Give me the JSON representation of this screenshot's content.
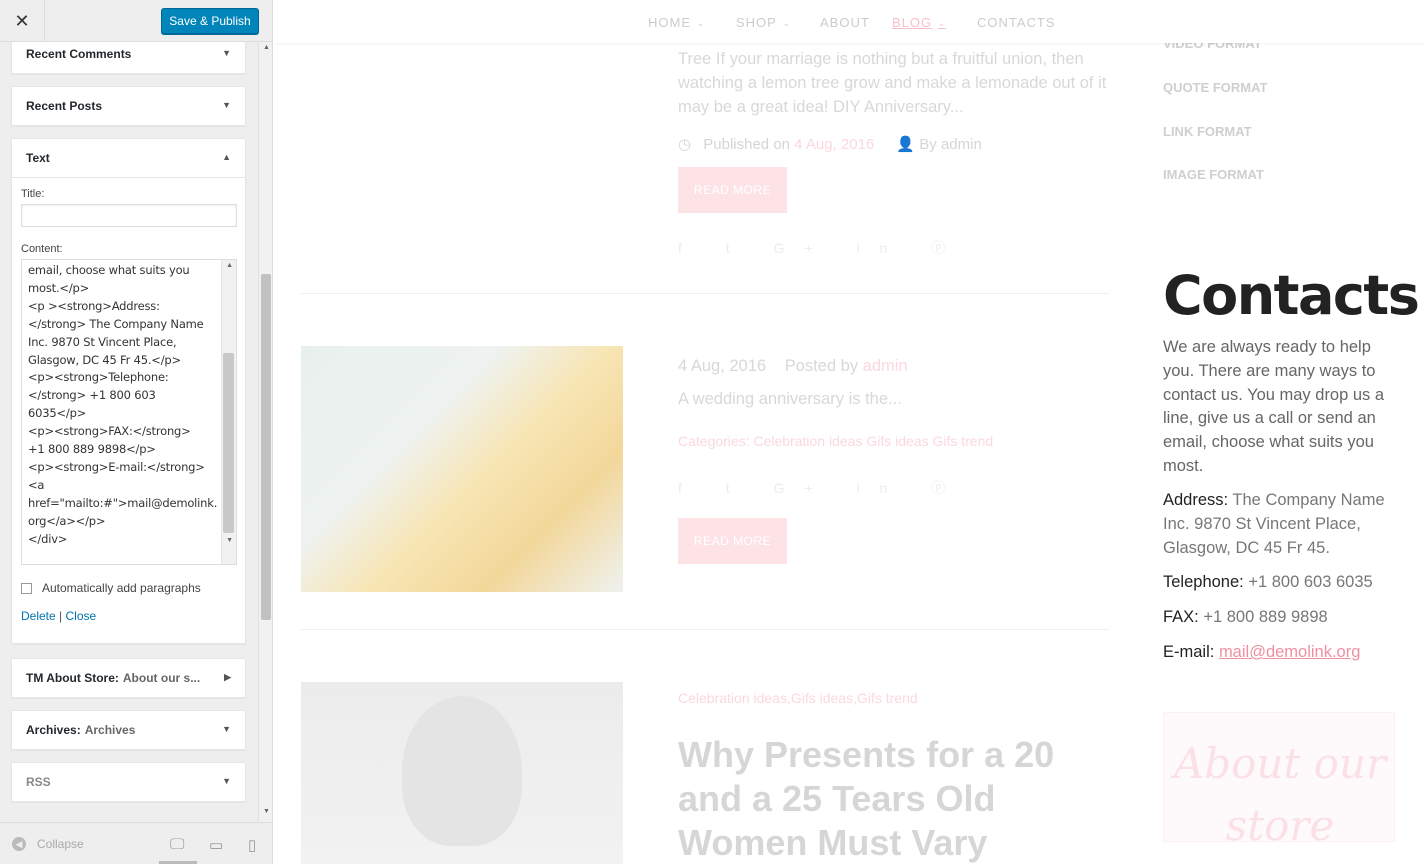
{
  "customizer": {
    "close_glyph": "✕",
    "save_label": "Save & Publish",
    "widgets": {
      "recent_comments": "Recent Comments",
      "recent_posts": "Recent Posts",
      "text": "Text",
      "about_store": {
        "name": "TM About Store:",
        "subtitle": "About our s..."
      },
      "archives": {
        "name": "Archives:",
        "subtitle": "Archives"
      },
      "rss": "RSS"
    },
    "text_widget": {
      "title_label": "Title:",
      "title_value": "",
      "content_label": "Content:",
      "content_value": "email, choose what suits you\nmost.</p>\n<p ><strong>Address:\n</strong> The Company Name\nInc. 9870 St Vincent Place,\nGlasgow, DC 45 Fr 45.</p>\n<p><strong>Telephone:\n</strong> +1 800 603\n6035</p>\n<p><strong>FAX:</strong>\n+1 800 889 9898</p>\n<p><strong>E-mail:</strong>\n<a\nhref=\"mailto:#\">mail@demolink.\norg</a></p>\n</div>",
      "auto_paragraphs_label": "Automatically add paragraphs",
      "auto_paragraphs_checked": false,
      "delete_label": "Delete",
      "separator": "|",
      "close_label": "Close"
    },
    "footer": {
      "collapse_label": "Collapse"
    }
  },
  "preview": {
    "nav": [
      {
        "label": "HOME",
        "caret": true
      },
      {
        "label": "SHOP",
        "caret": true
      },
      {
        "label": "ABOUT",
        "caret": false
      },
      {
        "label": "BLOG",
        "caret": true,
        "active": true
      },
      {
        "label": "CONTACTS",
        "caret": false
      }
    ],
    "post1": {
      "excerpt": "Tree If your marriage is nothing but a fruitful union, then watching a lemon tree grow and make a lemonade out of it may be a great idea! DIY Anniversary...",
      "published_prefix": "Published on",
      "published_date": "4 Aug, 2016",
      "author": "By admin",
      "read_more": "READ MORE"
    },
    "post2": {
      "date": "4 Aug, 2016",
      "posted_by": "Posted by",
      "author": "admin",
      "excerpt": "A wedding anniversary is the...",
      "categories": "Categories: Celebration ideas Gifs ideas Gifs trend",
      "read_more": "READ MORE"
    },
    "post3": {
      "categories": "Celebration ideas,Gifs ideas,Gifs trend",
      "title": "Why Presents for a 20 and a 25 Tears Old Women Must Vary"
    },
    "sidebar": {
      "links": [
        "VIDEO FORMAT",
        "QUOTE FORMAT",
        "LINK FORMAT",
        "IMAGE FORMAT"
      ],
      "contacts_title": "Contacts",
      "contacts_intro": "We are always ready to help you. There are many ways to contact us. You may drop us a line, give us a call or send an email, choose what suits you most.",
      "address_label": "Address:",
      "address_value": "The Company Name Inc. 9870 St Vincent Place, Glasgow, DC 45 Fr 45.",
      "telephone_label": "Telephone:",
      "telephone_value": "+1 800 603 6035",
      "fax_label": "FAX:",
      "fax_value": "+1 800 889 9898",
      "email_label": "E-mail:",
      "email_value": "mail@demolink.org",
      "about_title": "About our store"
    }
  }
}
